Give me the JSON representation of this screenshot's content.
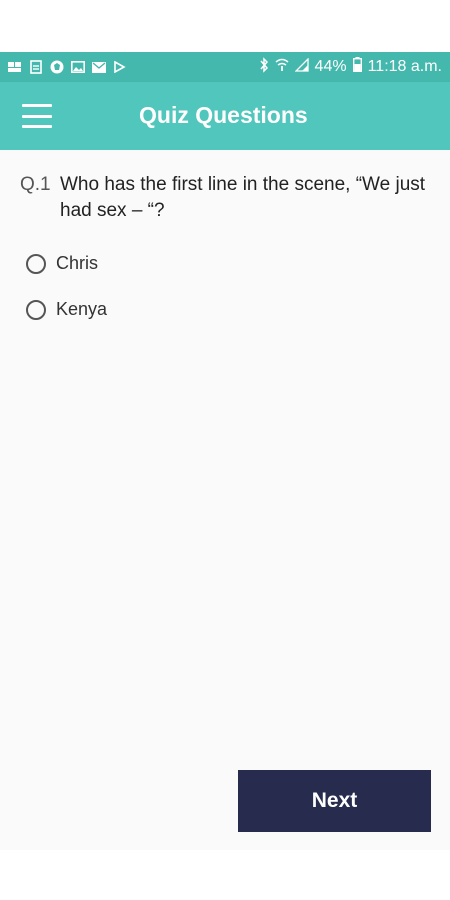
{
  "status_bar": {
    "left_icons": [
      "notification-icon",
      "document-icon",
      "shield-icon",
      "image-icon",
      "mail-icon",
      "play-icon"
    ],
    "bluetooth_icon": "bluetooth-icon",
    "wifi_icon": "wifi-icon",
    "signal_icon": "signal-icon",
    "battery_percent": "44%",
    "battery_icon": "battery-icon",
    "time": "11:18 a.m."
  },
  "app_bar": {
    "title": "Quiz Questions",
    "color": "#50c6bc"
  },
  "question": {
    "number": "Q.1",
    "text": "Who has the first line in the scene, “We just had sex – “?"
  },
  "options": [
    {
      "label": "Chris",
      "selected": false
    },
    {
      "label": "Kenya",
      "selected": false
    }
  ],
  "next_button": {
    "label": "Next",
    "color": "#272c4f"
  }
}
